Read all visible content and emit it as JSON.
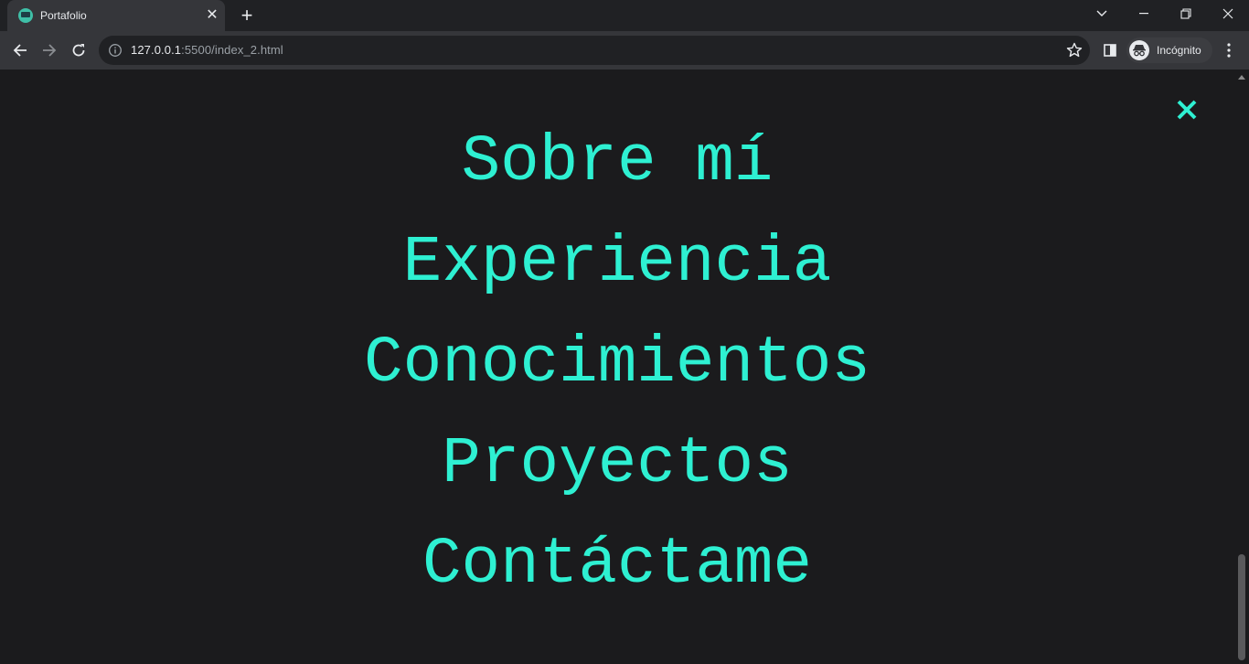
{
  "browser": {
    "tab": {
      "title": "Portafolio",
      "close_glyph": "✕",
      "favicon": "portfolio-favicon-icon"
    },
    "new_tab_glyph": "+",
    "address": {
      "host": "127.0.0.1",
      "rest": ":5500/index_2.html"
    },
    "profile": {
      "label": "Incógnito"
    }
  },
  "page": {
    "accent_color": "#2ef0d2",
    "background_color": "#1b1b1d",
    "close_icon": "close-icon",
    "menu": [
      {
        "label": "Sobre mí"
      },
      {
        "label": "Experiencia"
      },
      {
        "label": "Conocimientos"
      },
      {
        "label": "Proyectos"
      },
      {
        "label": "Contáctame"
      }
    ]
  }
}
